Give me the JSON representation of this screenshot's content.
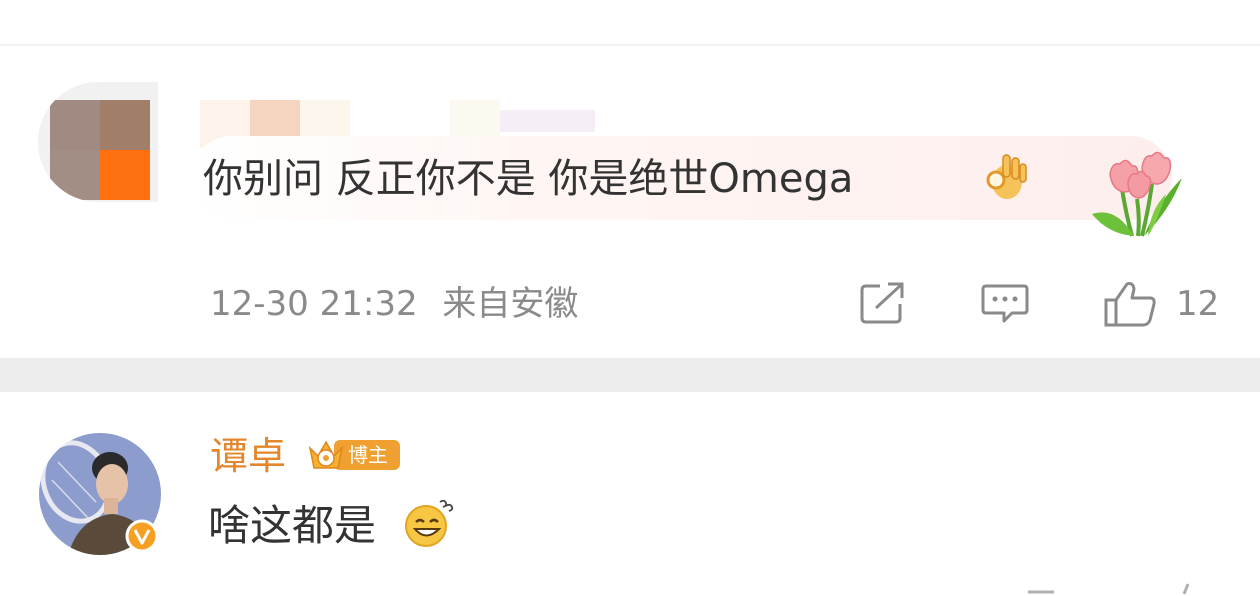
{
  "comments": [
    {
      "avatar": "blurred-avatar",
      "username": "",
      "text": "你别问 反正你不是 你是绝世Omega",
      "emoji": "ok-hand",
      "decoration": "tulips",
      "time": "12-30 21:32",
      "location": "来自安徽",
      "likes": "12",
      "actions": [
        "share-icon",
        "comment-icon",
        "like-icon"
      ]
    },
    {
      "avatar": "woman-with-tennis-racket",
      "username": "谭卓",
      "badge_label": "博主",
      "text": "啥这都是",
      "emoji": "grinning-sweat"
    }
  ],
  "colors": {
    "text": "#333333",
    "meta": "#8a8a8a",
    "username_vip": "#e3862c",
    "separator": "#ededed",
    "badge": "#f0a030"
  }
}
